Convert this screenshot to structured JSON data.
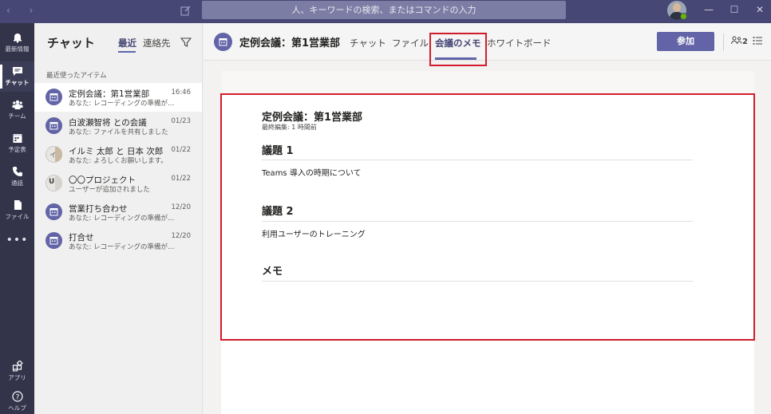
{
  "titlebar": {
    "nav_arrows": "‹ ›",
    "search_placeholder": "人、キーワードの検索、またはコマンドの入力",
    "window_controls": [
      "—",
      "☐",
      "✕"
    ]
  },
  "rail": {
    "items": [
      {
        "label": "最新情報",
        "icon": "bell-icon"
      },
      {
        "label": "チャット",
        "icon": "chat-icon",
        "active": true
      },
      {
        "label": "チーム",
        "icon": "teams-icon"
      },
      {
        "label": "予定表",
        "icon": "calendar-icon"
      },
      {
        "label": "通話",
        "icon": "phone-icon"
      },
      {
        "label": "ファイル",
        "icon": "file-icon"
      }
    ],
    "more": "•••",
    "bottom": [
      {
        "label": "アプリ",
        "icon": "apps-icon"
      },
      {
        "label": "ヘルプ",
        "icon": "help-icon"
      }
    ]
  },
  "chatpane": {
    "title": "チャット",
    "tabs": [
      {
        "label": "最近",
        "active": true
      },
      {
        "label": "連絡先",
        "active": false
      }
    ],
    "section_label": "最近使ったアイテム",
    "items": [
      {
        "name": "定例会議：第1営業部",
        "time": "16:46",
        "preview": "あなた: レコーディングの準備が…",
        "avatar": "meeting",
        "selected": true
      },
      {
        "name": "白波瀬智将 との会議",
        "time": "01/23",
        "preview": "あなた: ファイルを共有しました",
        "avatar": "meeting"
      },
      {
        "name": "イルミ 太郎 と 日本 次郎",
        "time": "01/22",
        "preview": "あなた: よろしくお願いします。",
        "avatar": "group",
        "initials": "イ"
      },
      {
        "name": "〇〇プロジェクト",
        "time": "01/22",
        "preview": "ユーザーが追加されました",
        "avatar": "group",
        "initials": "U"
      },
      {
        "name": "営業打ち合わせ",
        "time": "12/20",
        "preview": "あなた: レコーディングの準備が…",
        "avatar": "meeting"
      },
      {
        "name": "打合せ",
        "time": "12/20",
        "preview": "あなた: レコーディングの準備が…",
        "avatar": "meeting"
      }
    ]
  },
  "header": {
    "title": "定例会議：第1営業部",
    "tabs": [
      {
        "label": "チャット"
      },
      {
        "label": "ファイル"
      },
      {
        "label": "会議のメモ",
        "active": true
      },
      {
        "label": "ホワイトボード"
      }
    ],
    "join_label": "参加",
    "participants_count": "2"
  },
  "notes": {
    "title": "定例会議：第1営業部",
    "edited": "最終編集: 1 時間前",
    "sections": [
      {
        "heading": "議題 1",
        "body": "Teams 導入の時期について"
      },
      {
        "heading": "議題 2",
        "body": "利用ユーザーのトレーニング"
      },
      {
        "heading": "メモ",
        "body": ""
      }
    ]
  },
  "colors": {
    "brand": "#6264a7",
    "titlebar": "#464775",
    "rail": "#33344a",
    "highlight": "#d11d2b"
  }
}
